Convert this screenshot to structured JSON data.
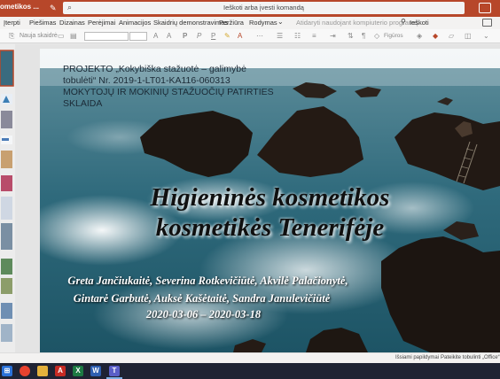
{
  "app": {
    "doc_title": "ometikos ...",
    "search_placeholder": "Ieškoti arba įvesti komandą"
  },
  "menu": {
    "tabs": [
      "Įterpti",
      "Piešimas",
      "Dizainas",
      "Perėjimai",
      "Animacijos",
      "Skaidrių demonstravimas",
      "Peržiūra",
      "Rodymas"
    ],
    "tell_me": "Atidaryti naudojant kompiuterio programą",
    "find": "Ieškoti"
  },
  "ribbon": {
    "new_slide": "Nauja skaidrė",
    "font_size_placeholder": "",
    "line_spacing": "Figūros"
  },
  "slide": {
    "project_lines": [
      "PROJEKTO „Kokybiška stažuotė – galimybė",
      "tobulėti“ Nr. 2019-1-LT01-KA116-060313",
      "MOKYTOJŲ IR MOKINIŲ STAŽUOČIŲ PATIRTIES",
      "SKLAIDA"
    ],
    "title_lines": [
      "Higieninės kosmetikos",
      "kosmetikės Tenerifėje"
    ],
    "author_lines": [
      "Greta Jančiukaitė, Severina Rotkevičiūtė, Akvilė Palačionytė,",
      "Gintarė Garbutė, Auksė Kašėtaitė, Sandra Janulevičiūtė",
      "2020-03-06 – 2020-03-18"
    ]
  },
  "status": {
    "help": "Išsiami papildymai",
    "feedback": "Pateikite tobulinti „Office“"
  },
  "colors": {
    "brand": "#b7472a",
    "taskbar": "#1f2333"
  },
  "icons": [
    "edit-icon",
    "search-icon",
    "comment-icon",
    "windows-start-icon",
    "chrome-icon",
    "files-icon",
    "pdf-icon",
    "excel-icon",
    "word-icon",
    "teams-icon"
  ]
}
